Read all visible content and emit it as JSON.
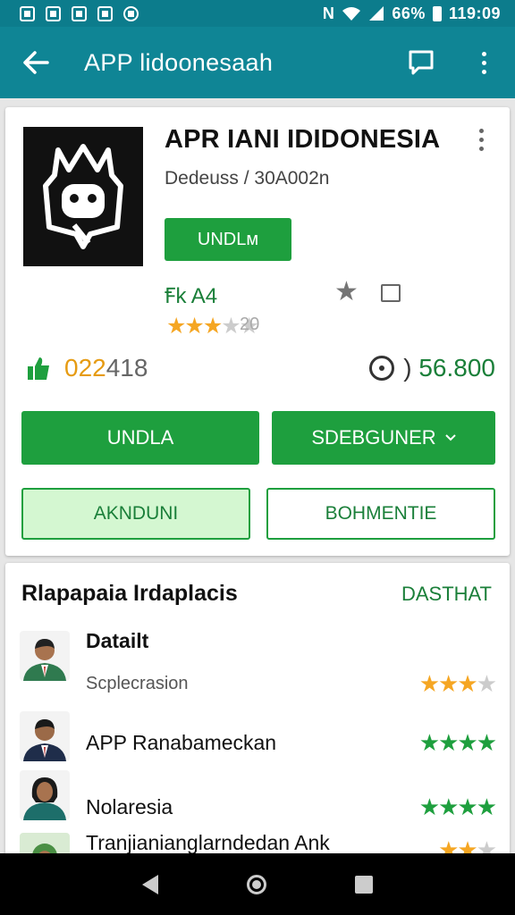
{
  "status_bar": {
    "signal_text": "N",
    "battery_text": "66%",
    "time": "119:09",
    "icons": [
      "gallery-icon",
      "mail-icon",
      "edit-icon",
      "chart-icon",
      "notification-icon",
      "wifi-icon",
      "signal-icon",
      "battery-icon"
    ]
  },
  "toolbar": {
    "back_icon": "arrow-left-icon",
    "title": "APP lidoonesaah",
    "actions": [
      "chat-icon",
      "more-vert-icon"
    ]
  },
  "app": {
    "name": "APR IANI IDIDONESIA",
    "developer": "Dedeuss / 30A002n",
    "install_small_label": "UNDLм",
    "rating_text": "Ꞙk A4",
    "stars": "★★★",
    "stars_dim": "★★",
    "stars_count_text": "20",
    "downloads_prefix": "022",
    "downloads_tail": "418",
    "price": "56.800",
    "price_prefix": ")",
    "colors": {
      "accent": "#1e9f3e",
      "toolbar": "#0f8595",
      "star": "#f5a623"
    }
  },
  "buttons": {
    "install": "UNDLA",
    "dropdown": "SDEBGUNER",
    "dropdown_icon": "chevron-down-icon",
    "secondary_left": "AKNDUNI",
    "secondary_right": "BOHMENTIE"
  },
  "reviews": {
    "title": "Rlapapaia Irdaplacis",
    "link": "DASTHAT",
    "items": [
      {
        "name": "Datailt",
        "subtitle": "Scplecrasion",
        "stars": "★★★",
        "dim": "★",
        "color": "orange"
      },
      {
        "name": "APP Ranabameckan",
        "subtitle": "",
        "stars": "★★★★",
        "dim": "",
        "color": "green"
      },
      {
        "name": "Nolaresia",
        "subtitle": "",
        "stars": "★★★★",
        "dim": "",
        "color": "green"
      },
      {
        "name": "Tranjianianglarndedan Ank",
        "subtitle": "",
        "stars": "★★",
        "dim": "★",
        "color": "orange"
      }
    ]
  },
  "nav": [
    "back-triangle-icon",
    "home-circle-icon",
    "recents-square-icon"
  ]
}
